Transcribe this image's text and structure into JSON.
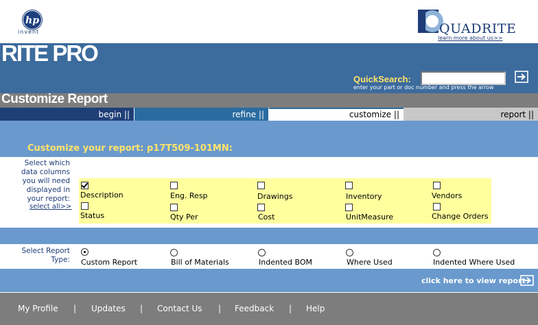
{
  "header": {
    "hp_invent": "invent",
    "quadrite_logo_text": "QUADRITE",
    "learn_more": "learn more about us>>",
    "app_title": "RITE PRO"
  },
  "quicksearch": {
    "label": "QuickSearch:",
    "value": "",
    "hint": "enter your part or doc number and press the arrow"
  },
  "page_title": "Customize Report",
  "tabs": [
    {
      "label": "begin ||"
    },
    {
      "label": "refine ||"
    },
    {
      "label": "customize ||"
    },
    {
      "label": "report ||"
    }
  ],
  "active_tab": "customize",
  "customize": {
    "heading": "Customize your report:  p17T509-101MN:",
    "select_columns_text": "Select which data columns you will need displayed in your report:",
    "select_all": "select all>>",
    "columns": [
      {
        "label": "Description",
        "checked": true
      },
      {
        "label": "Eng. Resp",
        "checked": false
      },
      {
        "label": "Drawings",
        "checked": false
      },
      {
        "label": "Inventory",
        "checked": false
      },
      {
        "label": "Vendors",
        "checked": false
      },
      {
        "label": "Status",
        "checked": false
      },
      {
        "label": "Qty Per",
        "checked": false
      },
      {
        "label": "Cost",
        "checked": false
      },
      {
        "label": "UnitMeasure",
        "checked": false
      },
      {
        "label": "Change Orders",
        "checked": false
      }
    ],
    "report_type_text": "Select Report Type:",
    "report_types": [
      {
        "label": "Custom Report",
        "selected": true
      },
      {
        "label": "Bill of Materials",
        "selected": false
      },
      {
        "label": "Indented BOM",
        "selected": false
      },
      {
        "label": "Where Used",
        "selected": false
      },
      {
        "label": "Indented Where Used",
        "selected": false
      }
    ],
    "view_report": "click here to view report"
  },
  "footer": {
    "links": [
      "My Profile",
      "Updates",
      "Contact Us",
      "Feedback",
      "Help"
    ],
    "separator": "|"
  },
  "colors": {
    "header_blue": "#3c6b9d",
    "section_blue": "#6a99cd",
    "title_gray": "#7d7d7d",
    "highlight_yellow": "#ffff9e",
    "quicksearch_yellow": "#ffe46a",
    "tab_begin": "#1f3f77",
    "tab_refine": "#2a6ca0",
    "tab_report": "#c8c8c8"
  }
}
